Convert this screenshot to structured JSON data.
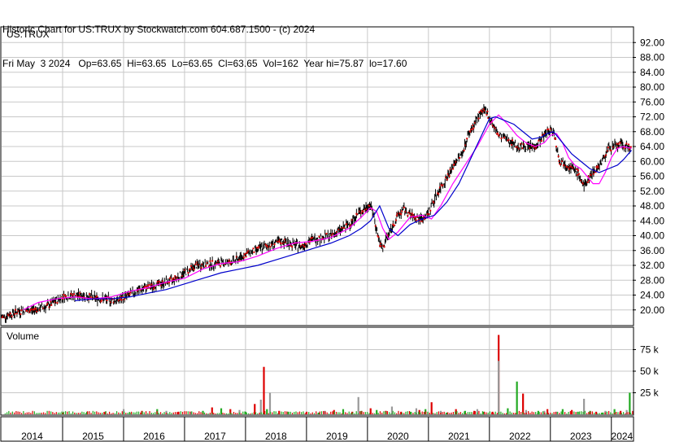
{
  "header": {
    "line1": "Historic Chart for US:TRUX by Stockwatch.com 604.687.1500 - (c) 2024",
    "line2": "Fri May  3 2024   Op=63.65  Hi=63.65  Lo=63.65  Cl=63.65  Vol=162  Year hi=75.87  lo=17.60"
  },
  "colors": {
    "price_bar": "#000000",
    "up_mark": "#dd0000",
    "ma_short": "#ff00ff",
    "ma_long": "#0000cc",
    "grid": "#c8c8c8",
    "vol_up": "#22aa22",
    "vol_down": "#dd0000",
    "vol_neutral": "#999999"
  },
  "chart_data": [
    {
      "type": "line",
      "title": "US:TRUX",
      "ylim": [
        16,
        96
      ],
      "y_ticks": [
        "92.00",
        "88.00",
        "84.00",
        "80.00",
        "76.00",
        "72.00",
        "68.00",
        "64.00",
        "60.00",
        "56.00",
        "52.00",
        "48.00",
        "44.00",
        "40.00",
        "36.00",
        "32.00",
        "28.00",
        "24.00",
        "20.00"
      ],
      "y_tick_values": [
        92,
        88,
        84,
        80,
        76,
        72,
        68,
        64,
        60,
        56,
        52,
        48,
        44,
        40,
        36,
        32,
        28,
        24,
        20
      ],
      "x_range": [
        2014.0,
        2024.35
      ],
      "series": [
        {
          "key": "price",
          "x": [
            2014.0,
            2014.25,
            2014.5,
            2014.75,
            2015.0,
            2015.3,
            2015.6,
            2015.9,
            2016.2,
            2016.5,
            2016.8,
            2017.0,
            2017.2,
            2017.5,
            2017.8,
            2018.0,
            2018.3,
            2018.6,
            2018.9,
            2019.1,
            2019.4,
            2019.7,
            2019.85,
            2019.98,
            2020.05,
            2020.12,
            2020.2,
            2020.25,
            2020.3,
            2020.4,
            2020.5,
            2020.6,
            2020.75,
            2020.9,
            2021.0,
            2021.1,
            2021.2,
            2021.35,
            2021.45,
            2021.55,
            2021.65,
            2021.75,
            2021.85,
            2021.95,
            2022.05,
            2022.15,
            2022.3,
            2022.45,
            2022.6,
            2022.75,
            2022.85,
            2022.95,
            2023.05,
            2023.15,
            2023.25,
            2023.35,
            2023.45,
            2023.55,
            2023.65,
            2023.75,
            2023.85,
            2023.95,
            2024.05,
            2024.15,
            2024.25,
            2024.33
          ],
          "values": [
            18,
            19.5,
            20,
            21,
            23.5,
            24,
            23,
            22.5,
            25,
            26.5,
            28,
            30,
            32,
            32.5,
            33,
            35,
            37,
            38.5,
            37,
            39,
            40,
            43,
            46,
            47.5,
            48.5,
            44,
            38,
            36,
            39,
            42,
            45.5,
            47,
            45,
            44.5,
            46,
            50,
            53,
            57,
            60,
            62,
            67,
            70,
            73,
            73.5,
            70,
            67,
            66,
            64,
            64,
            64,
            66,
            68,
            68.5,
            60,
            59.5,
            58,
            57,
            53,
            56,
            58,
            60,
            63.5,
            64,
            64.5,
            64,
            63.65
          ]
        },
        {
          "key": "ma_short",
          "x": [
            2014.35,
            2014.6,
            2014.9,
            2015.2,
            2015.5,
            2015.8,
            2016.1,
            2016.4,
            2016.7,
            2017.0,
            2017.3,
            2017.6,
            2017.9,
            2018.2,
            2018.5,
            2018.8,
            2019.1,
            2019.4,
            2019.7,
            2019.9,
            2020.05,
            2020.15,
            2020.25,
            2020.35,
            2020.5,
            2020.7,
            2020.9,
            2021.05,
            2021.2,
            2021.4,
            2021.6,
            2021.8,
            2022.0,
            2022.15,
            2022.3,
            2022.45,
            2022.6,
            2022.75,
            2022.9,
            2023.0,
            2023.1,
            2023.2,
            2023.3,
            2023.4,
            2023.5,
            2023.6,
            2023.7,
            2023.8,
            2023.9,
            2024.0,
            2024.1,
            2024.2,
            2024.33
          ],
          "values": [
            20,
            22,
            23,
            23.5,
            23,
            23.5,
            25,
            26,
            27.5,
            28.5,
            31,
            32.5,
            33,
            34.5,
            36.5,
            38,
            38.5,
            39.5,
            42,
            45,
            47.5,
            46.5,
            42,
            39,
            41,
            45,
            45.5,
            44.5,
            48,
            54,
            59,
            64,
            70,
            72.5,
            70,
            67,
            65,
            64,
            65,
            67,
            67.5,
            65,
            61,
            59,
            58,
            56,
            54,
            54,
            57,
            61,
            63.5,
            64,
            63.5
          ]
        },
        {
          "key": "ma_long",
          "x": [
            2015.2,
            2015.5,
            2015.8,
            2016.1,
            2016.4,
            2016.7,
            2017.0,
            2017.3,
            2017.6,
            2017.9,
            2018.2,
            2018.5,
            2018.8,
            2019.1,
            2019.4,
            2019.7,
            2019.9,
            2020.05,
            2020.2,
            2020.35,
            2020.5,
            2020.7,
            2020.9,
            2021.1,
            2021.3,
            2021.5,
            2021.7,
            2021.9,
            2022.0,
            2022.1,
            2022.25,
            2022.4,
            2022.55,
            2022.7,
            2022.85,
            2022.95,
            2023.05,
            2023.2,
            2023.35,
            2023.5,
            2023.65,
            2023.8,
            2023.95,
            2024.1,
            2024.2,
            2024.33
          ],
          "values": [
            22.5,
            23,
            23,
            23.5,
            24.5,
            25.5,
            27,
            28.5,
            30,
            31,
            32,
            33.5,
            35,
            36.5,
            38,
            40,
            42,
            44,
            48,
            42,
            40,
            43,
            44.5,
            45.5,
            49,
            54,
            61,
            68,
            71.5,
            72,
            71,
            70,
            68,
            66,
            66.5,
            67.5,
            68,
            65,
            62,
            60,
            58,
            57,
            58,
            59,
            60.5,
            63
          ]
        }
      ]
    },
    {
      "type": "bar",
      "title": "Volume",
      "ylim": [
        0,
        100
      ],
      "y_ticks": [
        "75 k",
        "50 k",
        "25 k"
      ],
      "y_tick_values": [
        75,
        50,
        25
      ],
      "x_range": [
        2014.0,
        2024.35
      ],
      "x_tick_labels": [
        "2014",
        "2015",
        "2016",
        "2017",
        "2018",
        "2019",
        "2020",
        "2021",
        "2022",
        "2023",
        "2024"
      ],
      "series": [
        {
          "name": "up",
          "x": [
            2015.4,
            2016.1,
            2016.55,
            2017.3,
            2017.6,
            2018.0,
            2018.35,
            2018.7,
            2019.2,
            2019.6,
            2019.9,
            2020.15,
            2020.7,
            2020.95,
            2021.3,
            2021.6,
            2021.9,
            2022.3,
            2022.45,
            2022.8,
            2023.2,
            2023.45,
            2023.65,
            2023.85,
            2024.05,
            2024.3
          ],
          "values": [
            3,
            2,
            6,
            4,
            7,
            3,
            6,
            3,
            2,
            6,
            4,
            5,
            3,
            6,
            2,
            4,
            3,
            7,
            38,
            4,
            6,
            3,
            4,
            2,
            6,
            25
          ]
        },
        {
          "name": "down",
          "x": [
            2015.0,
            2015.7,
            2016.3,
            2016.9,
            2017.45,
            2017.75,
            2018.15,
            2018.3,
            2018.55,
            2019.0,
            2019.45,
            2019.75,
            2020.05,
            2020.3,
            2020.55,
            2020.85,
            2021.05,
            2021.45,
            2021.75,
            2022.05,
            2022.15,
            2022.55,
            2022.95,
            2023.35,
            2023.75,
            2024.15
          ],
          "values": [
            2,
            3,
            4,
            3,
            8,
            6,
            12,
            55,
            4,
            3,
            5,
            3,
            7,
            4,
            3,
            5,
            14,
            6,
            4,
            3,
            92,
            24,
            6,
            5,
            3,
            4
          ]
        },
        {
          "name": "neutral",
          "x": [
            2016.0,
            2016.7,
            2017.1,
            2017.9,
            2018.25,
            2018.4,
            2019.3,
            2019.85,
            2020.4,
            2020.8,
            2021.2,
            2021.8,
            2022.15,
            2022.6,
            2022.9,
            2023.1,
            2023.55,
            2023.9,
            2024.25
          ],
          "values": [
            6,
            4,
            3,
            5,
            17,
            25,
            4,
            20,
            9,
            7,
            4,
            6,
            62,
            5,
            4,
            3,
            18,
            4,
            5
          ]
        }
      ]
    }
  ]
}
